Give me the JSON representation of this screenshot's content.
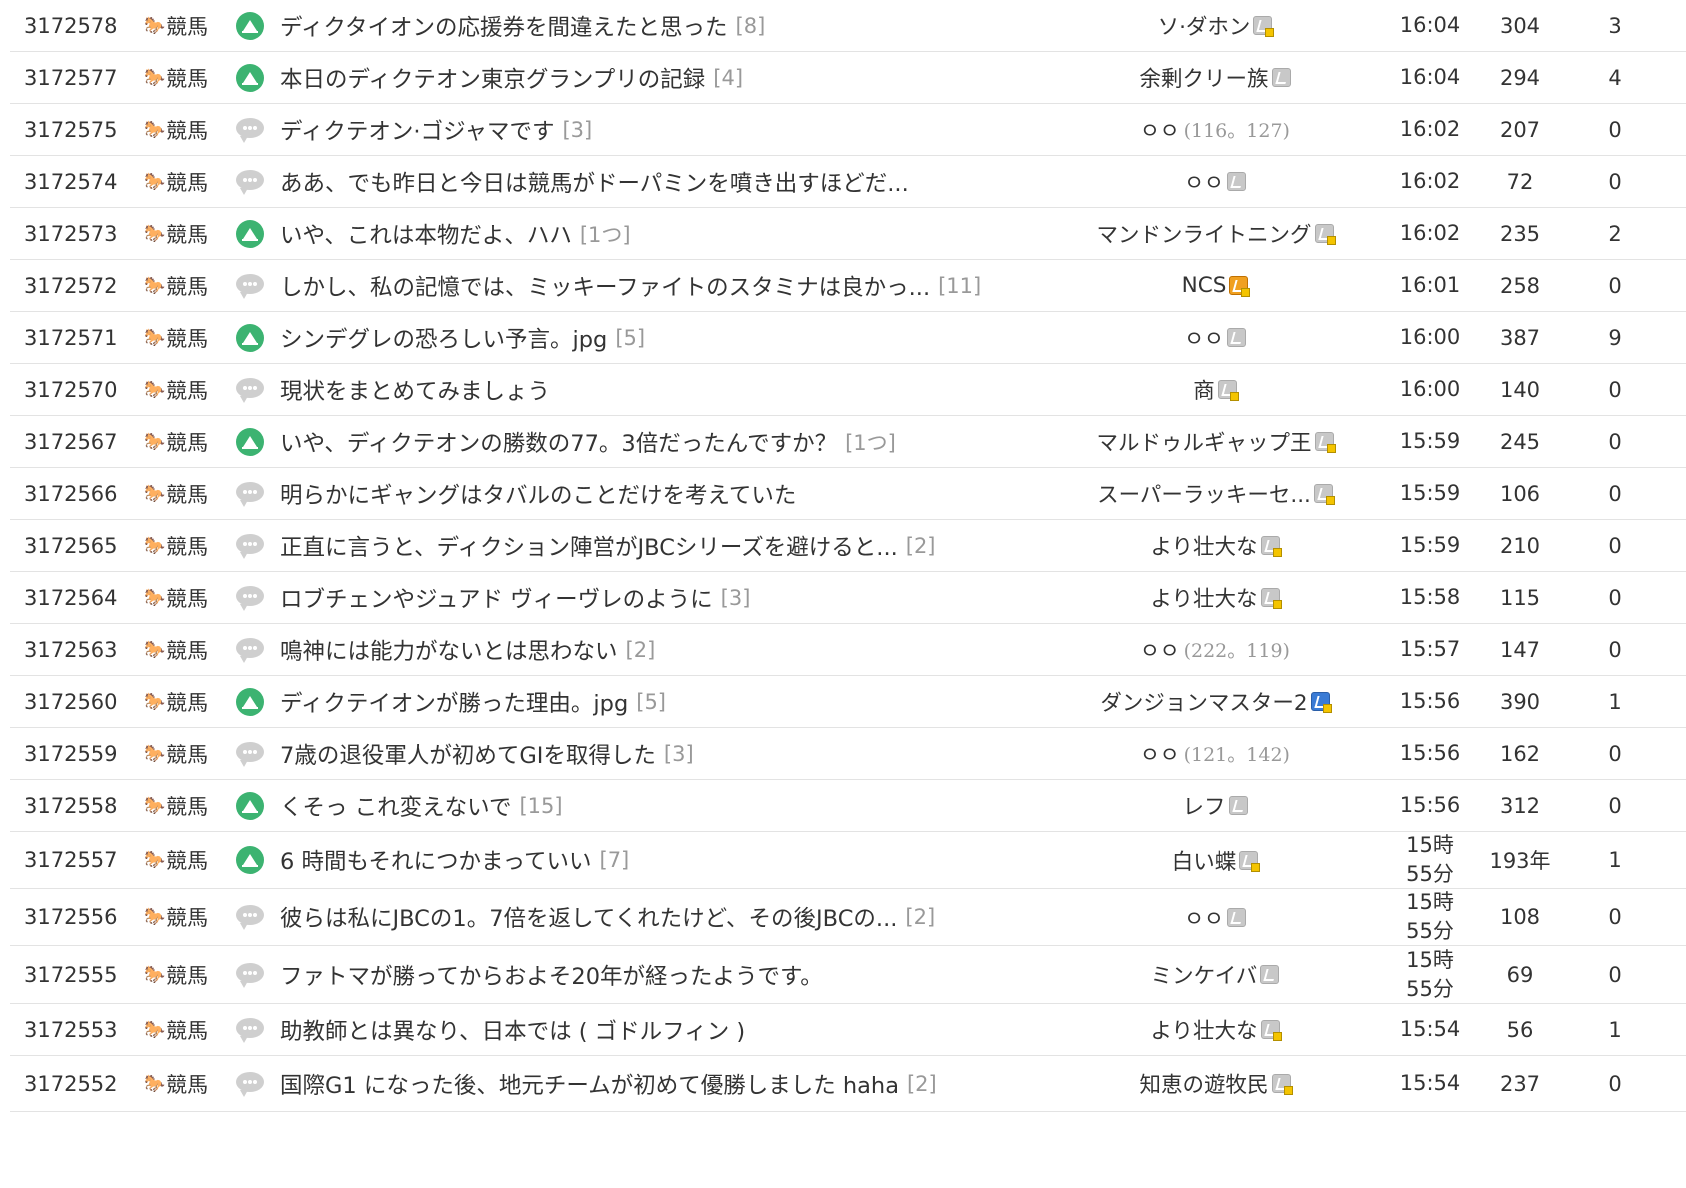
{
  "category_label": "競馬",
  "category_icon": "horse-icon",
  "colors": {
    "image_icon": "#3cb371",
    "text_icon": "#cfcfcf",
    "comment_count": "#999999",
    "divider": "#e3e3e3"
  },
  "rows": [
    {
      "num": "3172578",
      "type": "image",
      "title": "ディクタイオンの応援券を間違えたと思った",
      "comments": "[8]",
      "author": "ソ·ダホン",
      "badge": "half",
      "ip": "",
      "time": "16:04",
      "views": "304",
      "rec": "3"
    },
    {
      "num": "3172577",
      "type": "image",
      "title": "本日のディクテオン東京グランプリの記録",
      "comments": "[4]",
      "author": "余剰クリー族",
      "badge": "plain",
      "ip": "",
      "time": "16:04",
      "views": "294",
      "rec": "4"
    },
    {
      "num": "3172575",
      "type": "text",
      "title": "ディクテオン·ゴジャマです",
      "comments": "[3]",
      "author": "ㅇㅇ",
      "badge": "none",
      "ip": "(116。127)",
      "time": "16:02",
      "views": "207",
      "rec": "0"
    },
    {
      "num": "3172574",
      "type": "text",
      "title": "ああ、でも昨日と今日は競馬がドーパミンを噴き出すほどだ...",
      "comments": "",
      "author": "ㅇㅇ",
      "badge": "plain",
      "ip": "",
      "time": "16:02",
      "views": "72",
      "rec": "0"
    },
    {
      "num": "3172573",
      "type": "image",
      "title": "いや、これは本物だよ、ハハ",
      "comments": "[1つ]",
      "author": "マンドンライトニング",
      "badge": "half",
      "ip": "",
      "time": "16:02",
      "views": "235",
      "rec": "2"
    },
    {
      "num": "3172572",
      "type": "text",
      "title": "しかし、私の記憶では、ミッキーファイトのスタミナは良かっ...",
      "comments": "[11]",
      "author": "NCS",
      "badge": "fixed",
      "ip": "",
      "time": "16:01",
      "views": "258",
      "rec": "0"
    },
    {
      "num": "3172571",
      "type": "image",
      "title": "シンデグレの恐ろしい予言。jpg",
      "comments": "[5]",
      "author": "ㅇㅇ",
      "badge": "plain",
      "ip": "",
      "time": "16:00",
      "views": "387",
      "rec": "9"
    },
    {
      "num": "3172570",
      "type": "text",
      "title": "現状をまとめてみましょう",
      "comments": "",
      "author": "商",
      "badge": "half",
      "ip": "",
      "time": "16:00",
      "views": "140",
      "rec": "0"
    },
    {
      "num": "3172567",
      "type": "image",
      "title": "いや、ディクテオンの勝数の77。3倍だったんですか？",
      "comments": "[1つ]",
      "author": "マルドゥルギャップ王",
      "badge": "half",
      "ip": "",
      "time": "15:59",
      "views": "245",
      "rec": "0"
    },
    {
      "num": "3172566",
      "type": "text",
      "title": "明らかにギャングはタバルのことだけを考えていた",
      "comments": "",
      "author": "スーパーラッキーセ...",
      "badge": "half",
      "ip": "",
      "time": "15:59",
      "views": "106",
      "rec": "0"
    },
    {
      "num": "3172565",
      "type": "text",
      "title": "正直に言うと、ディクション陣営がJBCシリーズを避けると...",
      "comments": "[2]",
      "author": "より壮大な",
      "badge": "half",
      "ip": "",
      "time": "15:59",
      "views": "210",
      "rec": "0"
    },
    {
      "num": "3172564",
      "type": "text",
      "title": "ロブチェンやジュアド ヴィーヴレのように",
      "comments": "[3]",
      "author": "より壮大な",
      "badge": "half",
      "ip": "",
      "time": "15:58",
      "views": "115",
      "rec": "0"
    },
    {
      "num": "3172563",
      "type": "text",
      "title": "鳴神には能力がないとは思わない",
      "comments": "[2]",
      "author": "ㅇㅇ",
      "badge": "none",
      "ip": "(222。119)",
      "time": "15:57",
      "views": "147",
      "rec": "0"
    },
    {
      "num": "3172560",
      "type": "image",
      "title": "ディクテイオンが勝った理由。jpg",
      "comments": "[5]",
      "author": "ダンジョンマスター2",
      "badge": "blue",
      "ip": "",
      "time": "15:56",
      "views": "390",
      "rec": "1"
    },
    {
      "num": "3172559",
      "type": "text",
      "title": "7歳の退役軍人が初めてGIを取得した",
      "comments": "[3]",
      "author": "ㅇㅇ",
      "badge": "none",
      "ip": "(121。142)",
      "time": "15:56",
      "views": "162",
      "rec": "0"
    },
    {
      "num": "3172558",
      "type": "image",
      "title": "くそっ これ変えないで",
      "comments": "[15]",
      "author": "レフ",
      "badge": "plain",
      "ip": "",
      "time": "15:56",
      "views": "312",
      "rec": "0"
    },
    {
      "num": "3172557",
      "type": "image",
      "title": "6 時間もそれにつかまっていい",
      "comments": "[7]",
      "author": "白い蝶",
      "badge": "half",
      "ip": "",
      "time": "15時55分",
      "views": "193年",
      "rec": "1"
    },
    {
      "num": "3172556",
      "type": "text",
      "title": "彼らは私にJBCの1。7倍を返してくれたけど、その後JBCの...",
      "comments": "[2]",
      "author": "ㅇㅇ",
      "badge": "plain",
      "ip": "",
      "time": "15時55分",
      "views": "108",
      "rec": "0"
    },
    {
      "num": "3172555",
      "type": "text",
      "title": "ファトマが勝ってからおよそ20年が経ったようです。",
      "comments": "",
      "author": "ミンケイバ",
      "badge": "plain",
      "ip": "",
      "time": "15時55分",
      "views": "69",
      "rec": "0"
    },
    {
      "num": "3172553",
      "type": "text",
      "title": "助教師とは異なり、日本では ( ゴドルフィン )",
      "comments": "",
      "author": "より壮大な",
      "badge": "half",
      "ip": "",
      "time": "15:54",
      "views": "56",
      "rec": "1"
    },
    {
      "num": "3172552",
      "type": "text",
      "title": "国際G1 になった後、地元チームが初めて優勝しました haha",
      "comments": "[2]",
      "author": "知恵の遊牧民",
      "badge": "half",
      "ip": "",
      "time": "15:54",
      "views": "237",
      "rec": "0"
    }
  ]
}
